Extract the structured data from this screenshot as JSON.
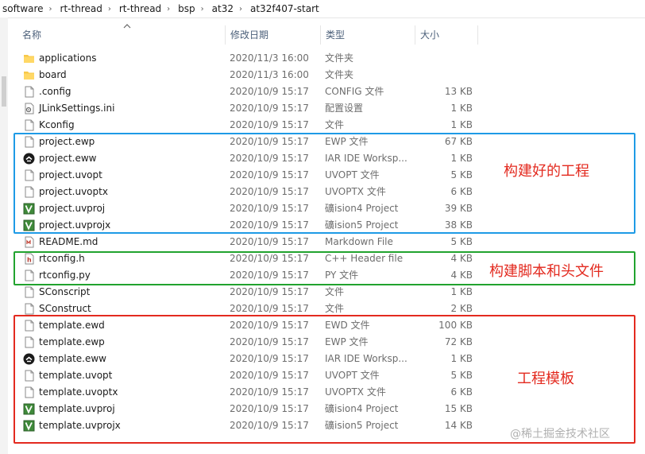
{
  "breadcrumb": [
    "software",
    "rt-thread",
    "rt-thread",
    "bsp",
    "at32",
    "at32f407-start"
  ],
  "columns": {
    "name": "名称",
    "date": "修改日期",
    "type": "类型",
    "size": "大小"
  },
  "rows": [
    {
      "icon": "folder-icon",
      "name": "applications",
      "date": "2020/11/3 16:00",
      "type": "文件夹",
      "size": ""
    },
    {
      "icon": "folder-icon",
      "name": "board",
      "date": "2020/11/3 16:00",
      "type": "文件夹",
      "size": ""
    },
    {
      "icon": "file-icon",
      "name": ".config",
      "date": "2020/10/9 15:17",
      "type": "CONFIG 文件",
      "size": "13 KB"
    },
    {
      "icon": "settings-file-icon",
      "name": "JLinkSettings.ini",
      "date": "2020/10/9 15:17",
      "type": "配置设置",
      "size": "1 KB"
    },
    {
      "icon": "file-icon",
      "name": "Kconfig",
      "date": "2020/10/9 15:17",
      "type": "文件",
      "size": "1 KB"
    },
    {
      "icon": "file-icon",
      "name": "project.ewp",
      "date": "2020/10/9 15:17",
      "type": "EWP 文件",
      "size": "67 KB"
    },
    {
      "icon": "iar-icon",
      "name": "project.eww",
      "date": "2020/10/9 15:17",
      "type": "IAR IDE Worksp...",
      "size": "1 KB"
    },
    {
      "icon": "file-icon",
      "name": "project.uvopt",
      "date": "2020/10/9 15:17",
      "type": "UVOPT 文件",
      "size": "5 KB"
    },
    {
      "icon": "file-icon",
      "name": "project.uvoptx",
      "date": "2020/10/9 15:17",
      "type": "UVOPTX 文件",
      "size": "6 KB"
    },
    {
      "icon": "keil-icon",
      "name": "project.uvproj",
      "date": "2020/10/9 15:17",
      "type": "礦ision4 Project",
      "size": "39 KB"
    },
    {
      "icon": "keil-icon",
      "name": "project.uvprojx",
      "date": "2020/10/9 15:17",
      "type": "礦ision5 Project",
      "size": "38 KB"
    },
    {
      "icon": "markdown-file-icon",
      "name": "README.md",
      "date": "2020/10/9 15:17",
      "type": "Markdown File",
      "size": "5 KB"
    },
    {
      "icon": "header-file-icon",
      "name": "rtconfig.h",
      "date": "2020/10/9 15:17",
      "type": "C++ Header file",
      "size": "4 KB"
    },
    {
      "icon": "file-icon",
      "name": "rtconfig.py",
      "date": "2020/10/9 15:17",
      "type": "PY 文件",
      "size": "4 KB"
    },
    {
      "icon": "file-icon",
      "name": "SConscript",
      "date": "2020/10/9 15:17",
      "type": "文件",
      "size": "1 KB"
    },
    {
      "icon": "file-icon",
      "name": "SConstruct",
      "date": "2020/10/9 15:17",
      "type": "文件",
      "size": "2 KB"
    },
    {
      "icon": "file-icon",
      "name": "template.ewd",
      "date": "2020/10/9 15:17",
      "type": "EWD 文件",
      "size": "100 KB"
    },
    {
      "icon": "file-icon",
      "name": "template.ewp",
      "date": "2020/10/9 15:17",
      "type": "EWP 文件",
      "size": "72 KB"
    },
    {
      "icon": "iar-icon",
      "name": "template.eww",
      "date": "2020/10/9 15:17",
      "type": "IAR IDE Worksp...",
      "size": "1 KB"
    },
    {
      "icon": "file-icon",
      "name": "template.uvopt",
      "date": "2020/10/9 15:17",
      "type": "UVOPT 文件",
      "size": "5 KB"
    },
    {
      "icon": "file-icon",
      "name": "template.uvoptx",
      "date": "2020/10/9 15:17",
      "type": "UVOPTX 文件",
      "size": "6 KB"
    },
    {
      "icon": "keil-icon",
      "name": "template.uvproj",
      "date": "2020/10/9 15:17",
      "type": "礦ision4 Project",
      "size": "15 KB"
    },
    {
      "icon": "keil-icon",
      "name": "template.uvprojx",
      "date": "2020/10/9 15:17",
      "type": "礦ision5 Project",
      "size": "14 KB"
    }
  ],
  "annotations": {
    "blue_label": "构建好的工程",
    "green_label": "构建脚本和头文件",
    "red_label": "工程模板",
    "blue_color": "#1e9be6",
    "green_color": "#22a32f",
    "red_color": "#e32a1f"
  },
  "watermark": "@稀土掘金技术社区"
}
